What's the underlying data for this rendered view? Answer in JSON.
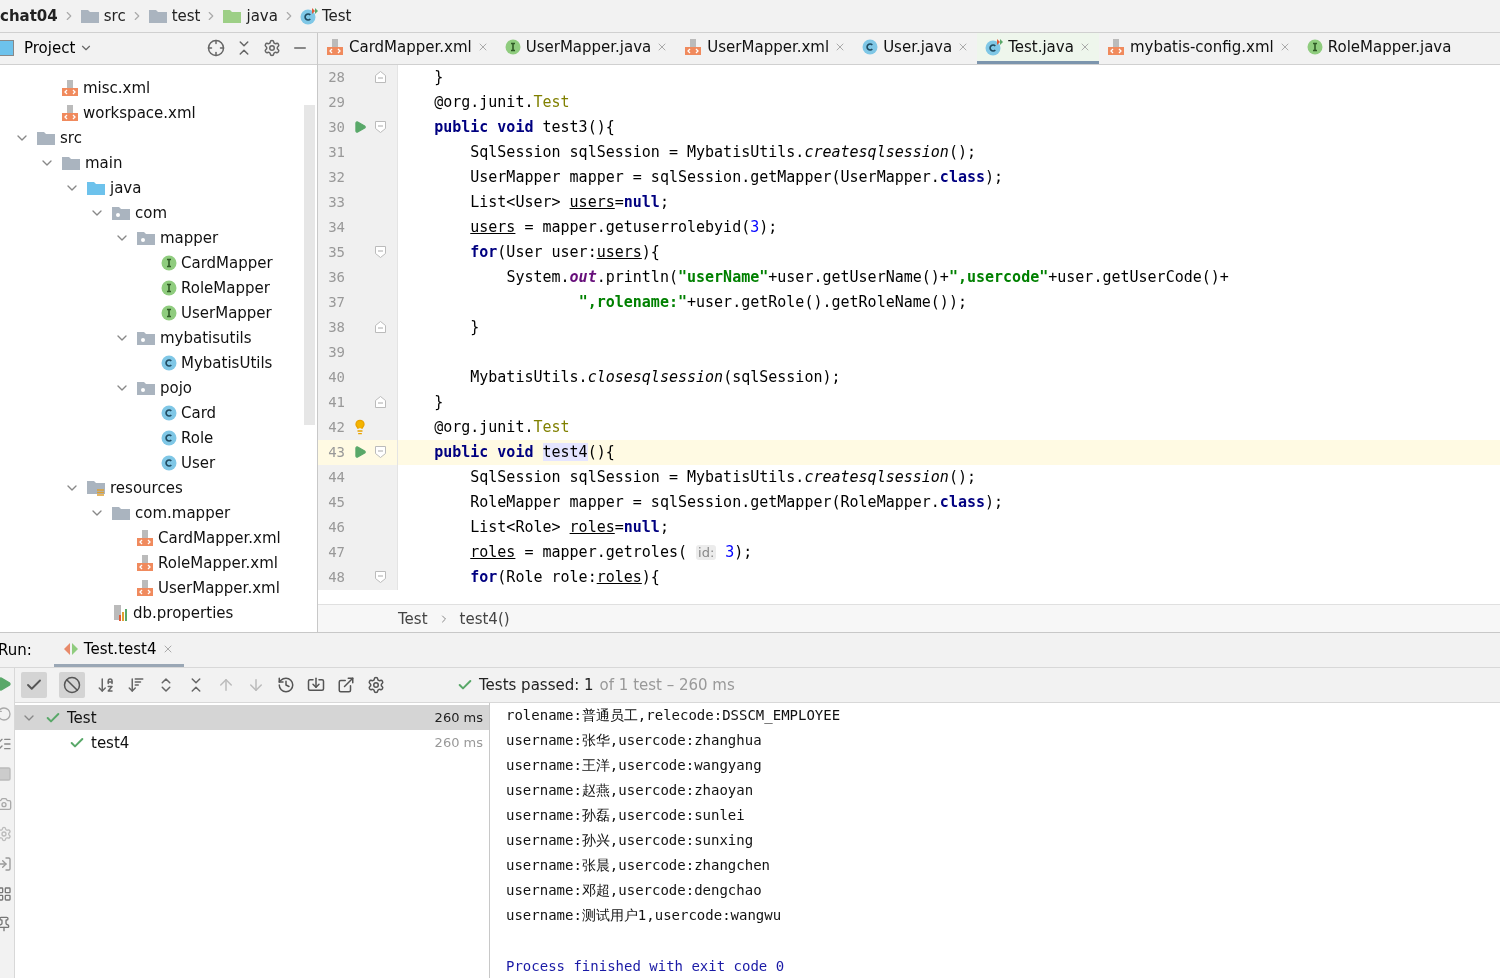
{
  "breadcrumbs": [
    {
      "label": "chat04",
      "kind": "module"
    },
    {
      "label": "src",
      "kind": "folder"
    },
    {
      "label": "test",
      "kind": "folder"
    },
    {
      "label": "java",
      "kind": "test-folder"
    },
    {
      "label": "Test",
      "kind": "test-class"
    }
  ],
  "project_panel": {
    "title": "Project",
    "tree": {
      "leading_items": [
        {
          "label": "misc.xml",
          "kind": "xml"
        },
        {
          "label": "workspace.xml",
          "kind": "xml"
        }
      ],
      "items": [
        {
          "label": "src",
          "kind": "folder",
          "expanded": true,
          "children": [
            {
              "label": "main",
              "kind": "folder",
              "expanded": true,
              "children": [
                {
                  "label": "java",
                  "kind": "source-folder",
                  "expanded": true,
                  "children": [
                    {
                      "label": "com",
                      "kind": "package",
                      "expanded": true,
                      "children": [
                        {
                          "label": "mapper",
                          "kind": "package",
                          "expanded": true,
                          "children": [
                            {
                              "label": "CardMapper",
                              "kind": "interface"
                            },
                            {
                              "label": "RoleMapper",
                              "kind": "interface"
                            },
                            {
                              "label": "UserMapper",
                              "kind": "interface"
                            }
                          ]
                        },
                        {
                          "label": "mybatisutils",
                          "kind": "package",
                          "expanded": true,
                          "children": [
                            {
                              "label": "MybatisUtils",
                              "kind": "class"
                            }
                          ]
                        },
                        {
                          "label": "pojo",
                          "kind": "package",
                          "expanded": true,
                          "children": [
                            {
                              "label": "Card",
                              "kind": "class"
                            },
                            {
                              "label": "Role",
                              "kind": "class"
                            },
                            {
                              "label": "User",
                              "kind": "class"
                            }
                          ]
                        }
                      ]
                    }
                  ]
                },
                {
                  "label": "resources",
                  "kind": "resources-folder",
                  "expanded": true,
                  "children": [
                    {
                      "label": "com.mapper",
                      "kind": "folder",
                      "expanded": true,
                      "children": [
                        {
                          "label": "CardMapper.xml",
                          "kind": "xml"
                        },
                        {
                          "label": "RoleMapper.xml",
                          "kind": "xml"
                        },
                        {
                          "label": "UserMapper.xml",
                          "kind": "xml"
                        }
                      ]
                    },
                    {
                      "label": "db.properties",
                      "kind": "properties"
                    }
                  ]
                }
              ]
            }
          ]
        }
      ]
    }
  },
  "editor": {
    "tabs": [
      {
        "label": "CardMapper.xml",
        "kind": "xml",
        "selected": false,
        "closable": true
      },
      {
        "label": "UserMapper.java",
        "kind": "interface",
        "selected": false,
        "closable": true
      },
      {
        "label": "UserMapper.xml",
        "kind": "xml",
        "selected": false,
        "closable": true
      },
      {
        "label": "User.java",
        "kind": "class",
        "selected": false,
        "closable": true
      },
      {
        "label": "Test.java",
        "kind": "test-class",
        "selected": true,
        "closable": true
      },
      {
        "label": "mybatis-config.xml",
        "kind": "xml",
        "selected": false,
        "closable": true
      },
      {
        "label": "RoleMapper.java",
        "kind": "interface",
        "selected": false,
        "closable": false
      }
    ],
    "lines": [
      {
        "number": "28",
        "fold_end": true,
        "tokens": [
          {
            "text": "    }",
            "kind": "plain"
          }
        ]
      },
      {
        "number": "29",
        "tokens": [
          {
            "text": "    @org.junit.",
            "kind": "plain"
          },
          {
            "text": "Test",
            "kind": "annotation"
          }
        ]
      },
      {
        "number": "30",
        "run": true,
        "fold_start": true,
        "tokens": [
          {
            "text": "    public void",
            "kind": "keyword"
          },
          {
            "text": " test3(){",
            "kind": "plain"
          }
        ]
      },
      {
        "number": "31",
        "tokens": [
          {
            "text": "        SqlSession sqlSession = MybatisUtils.",
            "kind": "plain"
          },
          {
            "text": "createsqlsession",
            "kind": "static"
          },
          {
            "text": "();",
            "kind": "plain"
          }
        ]
      },
      {
        "number": "32",
        "tokens": [
          {
            "text": "        UserMapper mapper = sqlSession.getMapper(UserMapper.",
            "kind": "plain"
          },
          {
            "text": "class",
            "kind": "keyword"
          },
          {
            "text": ");",
            "kind": "plain"
          }
        ]
      },
      {
        "number": "33",
        "tokens": [
          {
            "text": "        List<User> ",
            "kind": "plain"
          },
          {
            "text": "users",
            "kind": "variable"
          },
          {
            "text": "=",
            "kind": "plain"
          },
          {
            "text": "null",
            "kind": "keyword"
          },
          {
            "text": ";",
            "kind": "plain"
          }
        ]
      },
      {
        "number": "34",
        "tokens": [
          {
            "text": "        users",
            "kind": "variable"
          },
          {
            "text": " = mapper.getuserrolebyid(",
            "kind": "plain"
          },
          {
            "text": "3",
            "kind": "number"
          },
          {
            "text": ");",
            "kind": "plain"
          }
        ]
      },
      {
        "number": "35",
        "fold_start": true,
        "tokens": [
          {
            "text": "        for",
            "kind": "keyword"
          },
          {
            "text": "(User user:",
            "kind": "plain"
          },
          {
            "text": "users",
            "kind": "variable"
          },
          {
            "text": "){",
            "kind": "plain"
          }
        ]
      },
      {
        "number": "36",
        "tokens": [
          {
            "text": "            System.",
            "kind": "plain"
          },
          {
            "text": "out",
            "kind": "field"
          },
          {
            "text": ".println(",
            "kind": "plain"
          },
          {
            "text": "\"userName\"",
            "kind": "string"
          },
          {
            "text": "+user.getUserName()+",
            "kind": "plain"
          },
          {
            "text": "\",usercode\"",
            "kind": "string"
          },
          {
            "text": "+user.getUserCode()+",
            "kind": "plain"
          }
        ]
      },
      {
        "number": "37",
        "tokens": [
          {
            "text": "                    \",rolename:\"",
            "kind": "string"
          },
          {
            "text": "+user.getRole().getRoleName());",
            "kind": "plain"
          }
        ]
      },
      {
        "number": "38",
        "fold_end": true,
        "tokens": [
          {
            "text": "        }",
            "kind": "plain"
          }
        ]
      },
      {
        "number": "39"
      },
      {
        "number": "40",
        "tokens": [
          {
            "text": "        MybatisUtils.",
            "kind": "plain"
          },
          {
            "text": "closesqlsession",
            "kind": "static"
          },
          {
            "text": "(sqlSession);",
            "kind": "plain"
          }
        ]
      },
      {
        "number": "41",
        "fold_end": true,
        "tokens": [
          {
            "text": "    }",
            "kind": "plain"
          }
        ]
      },
      {
        "number": "42",
        "bulb": true,
        "tokens": [
          {
            "text": "    @org.junit.",
            "kind": "plain"
          },
          {
            "text": "Test",
            "kind": "annotation"
          }
        ]
      },
      {
        "number": "43",
        "run": true,
        "current": true,
        "fold_start": true,
        "tokens": [
          {
            "text": "    public void ",
            "kind": "keyword"
          },
          {
            "text": "test4",
            "kind": "highlight"
          },
          {
            "text": "(){",
            "kind": "plain"
          }
        ]
      },
      {
        "number": "44",
        "tokens": [
          {
            "text": "        SqlSession sqlSession = MybatisUtils.",
            "kind": "plain"
          },
          {
            "text": "createsqlsession",
            "kind": "static"
          },
          {
            "text": "();",
            "kind": "plain"
          }
        ]
      },
      {
        "number": "45",
        "tokens": [
          {
            "text": "        RoleMapper mapper = sqlSession.getMapper(RoleMapper.",
            "kind": "plain"
          },
          {
            "text": "class",
            "kind": "keyword"
          },
          {
            "text": ");",
            "kind": "plain"
          }
        ]
      },
      {
        "number": "46",
        "tokens": [
          {
            "text": "        List<Role> ",
            "kind": "plain"
          },
          {
            "text": "roles",
            "kind": "variable"
          },
          {
            "text": "=",
            "kind": "plain"
          },
          {
            "text": "null",
            "kind": "keyword"
          },
          {
            "text": ";",
            "kind": "plain"
          }
        ]
      },
      {
        "number": "47",
        "tokens": [
          {
            "text": "        roles",
            "kind": "variable"
          },
          {
            "text": " = mapper.getroles( ",
            "kind": "plain"
          },
          {
            "text": "id:",
            "kind": "hint"
          },
          {
            "text": " 3",
            "kind": "number"
          },
          {
            "text": ");",
            "kind": "plain"
          }
        ]
      },
      {
        "number": "48",
        "fold_start": true,
        "tokens": [
          {
            "text": "        for",
            "kind": "keyword"
          },
          {
            "text": "(Role role:",
            "kind": "plain"
          },
          {
            "text": "roles",
            "kind": "variable"
          },
          {
            "text": "){",
            "kind": "plain"
          }
        ]
      }
    ],
    "breadcrumbs": [
      "Test",
      "test4()"
    ]
  },
  "run_panel": {
    "label": "Run:",
    "tab": "Test.test4",
    "status": {
      "passed": "Tests passed: 1",
      "rest": "of 1 test – 260 ms"
    },
    "tests": [
      {
        "label": "Test",
        "time": "260 ms",
        "passed": true,
        "selected": true,
        "expanded": true,
        "children": [
          {
            "label": "test4",
            "time": "260 ms",
            "passed": true,
            "selected": false
          }
        ]
      }
    ],
    "console": [
      {
        "text": "rolename:普通员工,relecode:DSSCM_EMPLOYEE",
        "kind": "out"
      },
      {
        "text": "username:张华,usercode:zhanghua",
        "kind": "out"
      },
      {
        "text": "username:王洋,usercode:wangyang",
        "kind": "out"
      },
      {
        "text": "username:赵燕,usercode:zhaoyan",
        "kind": "out"
      },
      {
        "text": "username:孙磊,usercode:sunlei",
        "kind": "out"
      },
      {
        "text": "username:孙兴,usercode:sunxing",
        "kind": "out"
      },
      {
        "text": "username:张晨,usercode:zhangchen",
        "kind": "out"
      },
      {
        "text": "username:邓超,usercode:dengchao",
        "kind": "out"
      },
      {
        "text": "username:测试用户1,usercode:wangwu",
        "kind": "out"
      },
      {
        "text": "Process finished with exit code 0",
        "kind": "exit"
      }
    ]
  }
}
